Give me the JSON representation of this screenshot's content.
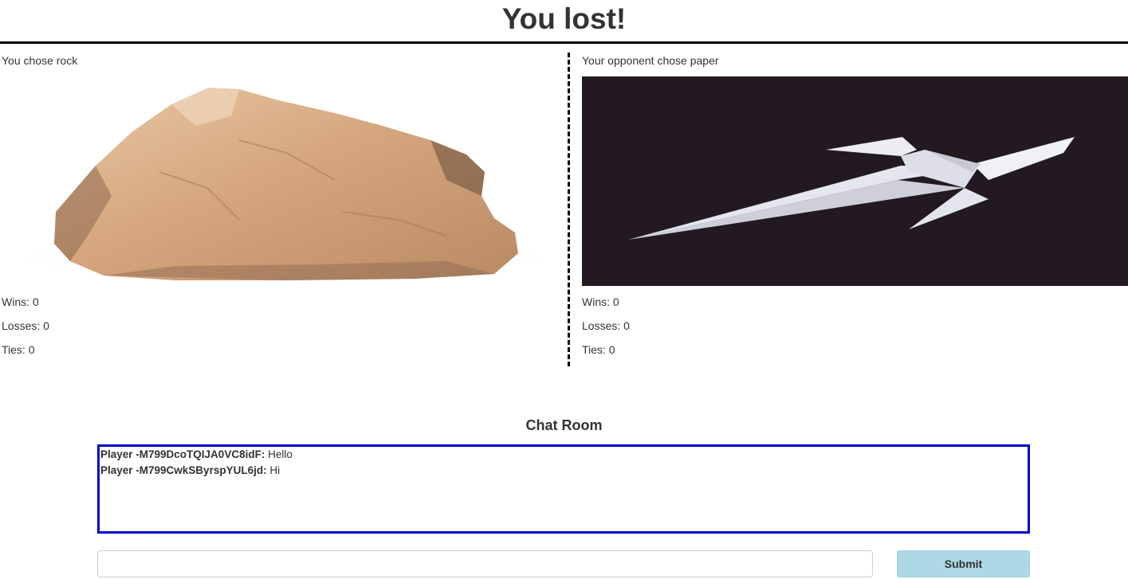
{
  "result": {
    "title": "You lost!"
  },
  "player": {
    "choice_text": "You chose rock",
    "choice_icon": "rock-image",
    "wins_text": "Wins: 0",
    "losses_text": "Losses: 0",
    "ties_text": "Ties: 0"
  },
  "opponent": {
    "choice_text": "Your opponent chose paper",
    "choice_icon": "paper-image",
    "wins_text": "Wins: 0",
    "losses_text": "Losses: 0",
    "ties_text": "Ties: 0"
  },
  "chat": {
    "heading": "Chat Room",
    "messages": [
      {
        "author": "Player -M799DcoTQIJA0VC8idF:",
        "text": " Hello"
      },
      {
        "author": "Player -M799CwkSByrspYUL6jd:",
        "text": " Hi"
      }
    ],
    "input_value": "",
    "submit_label": "Submit"
  },
  "colors": {
    "chat_border": "#0000cc",
    "submit_bg": "#add8e6",
    "paper_bg": "#231a21"
  }
}
